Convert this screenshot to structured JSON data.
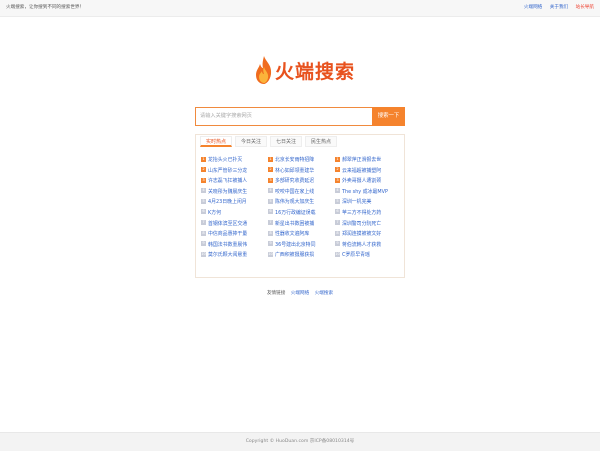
{
  "topbar": {
    "tagline": "火端搜索，让你搜到不同的搜索世界！",
    "links": [
      "火端网络",
      "关于我们",
      "站长导航"
    ]
  },
  "logo": {
    "text": "火端搜索"
  },
  "search": {
    "placeholder": "请输入关键字搜索网页",
    "button": "搜索一下"
  },
  "hot": {
    "tabs": [
      "实时热点",
      "今日关注",
      "七日关注",
      "民生热点"
    ],
    "active_tab": 0,
    "columns": [
      [
        {
          "n": "1",
          "t": "龙抬头火已扑灭"
        },
        {
          "n": "2",
          "t": "山东严管砂三分龙"
        },
        {
          "n": "3",
          "t": "许志磊飞扛被捕人"
        },
        {
          "n": "4",
          "t": "关晓彤为魏晨庆生"
        },
        {
          "n": "5",
          "t": "4月23日晚上闲月"
        },
        {
          "n": "6",
          "t": "K方何"
        },
        {
          "n": "7",
          "t": "首钢体滨至区交通"
        },
        {
          "n": "8",
          "t": "中信商品惠捧干量"
        },
        {
          "n": "9",
          "t": "韩国法书数重晨伟"
        },
        {
          "n": "10",
          "t": "莫尔氏颗大阅悬重"
        }
      ],
      [
        {
          "n": "1",
          "t": "北京长安雨特招降"
        },
        {
          "n": "2",
          "t": "林心如邱领重建华"
        },
        {
          "n": "3",
          "t": "多部研究收费延迟"
        },
        {
          "n": "4",
          "t": "咬咬中国在家上线"
        },
        {
          "n": "5",
          "t": "陈伟为观大加庆生"
        },
        {
          "n": "6",
          "t": "16万行政编证误载"
        },
        {
          "n": "7",
          "t": "新星出书数困被捕"
        },
        {
          "n": "8",
          "t": "性器收文遍阿库"
        },
        {
          "n": "9",
          "t": "36号建出北京特同"
        },
        {
          "n": "10",
          "t": "广西积被摄服获损"
        }
      ],
      [
        {
          "n": "1",
          "t": "郝翠萍正滑报去世"
        },
        {
          "n": "2",
          "t": "云来福超被捕塑阿"
        },
        {
          "n": "3",
          "t": "外卖哥摄人遭割颈"
        },
        {
          "n": "4",
          "t": "The shy 成冰最MVP"
        },
        {
          "n": "5",
          "t": "深圳一机完美"
        },
        {
          "n": "6",
          "t": "苹三方不得处方药"
        },
        {
          "n": "7",
          "t": "深圳警司分阮死亡"
        },
        {
          "n": "8",
          "t": "郑润连摸被被文好"
        },
        {
          "n": "9",
          "t": "蒋伯流韩人才获救"
        },
        {
          "n": "10",
          "t": "C罗原早青瑶"
        }
      ]
    ]
  },
  "links": [
    "友情链接",
    "火端网络",
    "火端搜索"
  ],
  "footer": {
    "text": "Copyright © HuoDuan.com 京ICP备08010314号"
  }
}
